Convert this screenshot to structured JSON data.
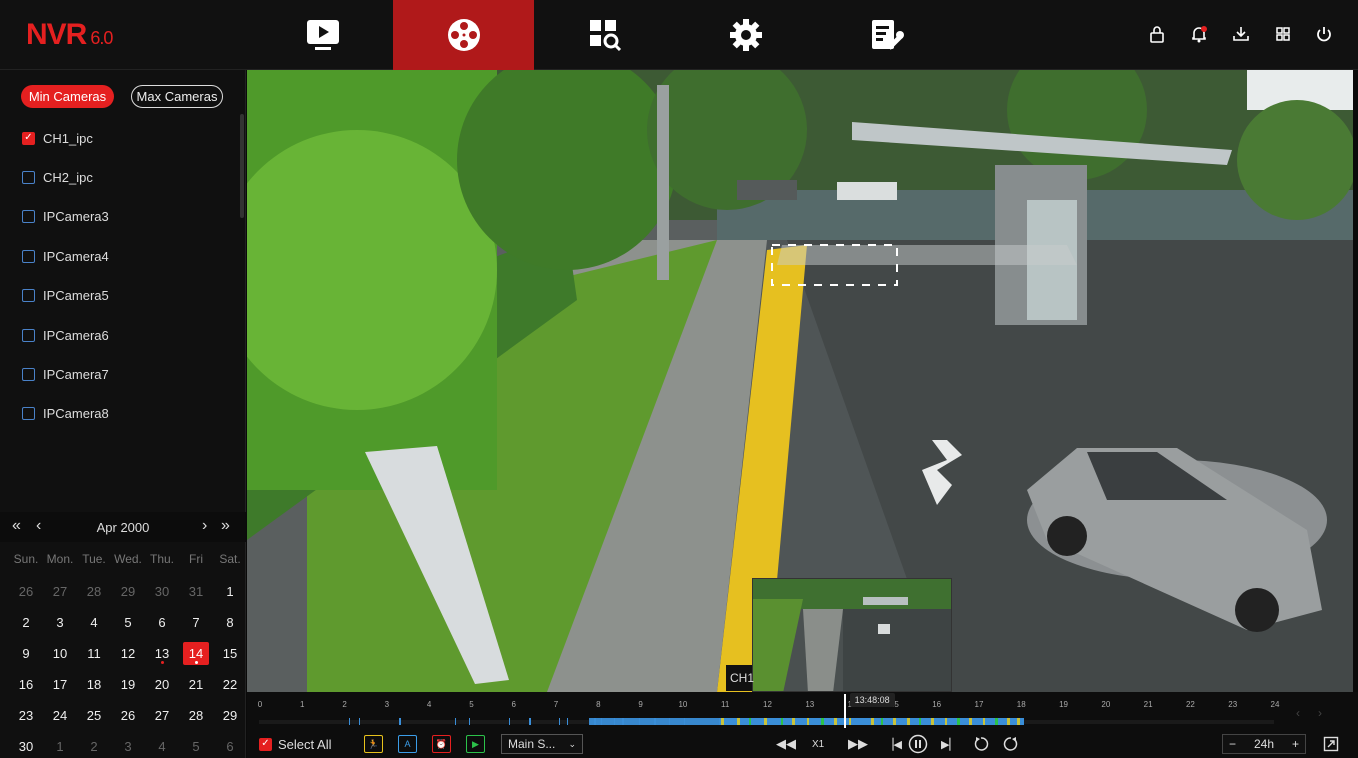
{
  "app": {
    "logo_main": "NVR",
    "logo_version": "6.0"
  },
  "nav_tabs": [
    {
      "name": "live-view",
      "icon": "play-screen-icon"
    },
    {
      "name": "playback",
      "icon": "film-reel-icon",
      "active": true
    },
    {
      "name": "search",
      "icon": "grid-search-icon"
    },
    {
      "name": "settings",
      "icon": "gear-icon"
    },
    {
      "name": "maintenance",
      "icon": "doc-wrench-icon"
    }
  ],
  "system_icons": [
    "lock-icon",
    "alarm-bell-icon",
    "download-icon",
    "layout-grid-icon",
    "power-icon"
  ],
  "sidebar": {
    "min_cameras_label": "Min Cameras",
    "max_cameras_label": "Max Cameras",
    "cameras": [
      {
        "label": "CH1_ipc",
        "checked": true
      },
      {
        "label": "CH2_ipc",
        "checked": false
      },
      {
        "label": "IPCamera3",
        "checked": false
      },
      {
        "label": "IPCamera4",
        "checked": false
      },
      {
        "label": "IPCamera5",
        "checked": false
      },
      {
        "label": "IPCamera6",
        "checked": false
      },
      {
        "label": "IPCamera7",
        "checked": false
      },
      {
        "label": "IPCamera8",
        "checked": false
      }
    ]
  },
  "calendar": {
    "month_label": "Apr 2000",
    "nav": {
      "prev_year": "«",
      "prev_month": "‹",
      "next_month": "›",
      "next_year": "»"
    },
    "weekdays": [
      "Sun.",
      "Mon.",
      "Tue.",
      "Wed.",
      "Thu.",
      "Fri",
      "Sat."
    ],
    "weeks": [
      [
        {
          "d": "26",
          "o": true
        },
        {
          "d": "27",
          "o": true
        },
        {
          "d": "28",
          "o": true
        },
        {
          "d": "29",
          "o": true
        },
        {
          "d": "30",
          "o": true
        },
        {
          "d": "31",
          "o": true
        },
        {
          "d": "1"
        }
      ],
      [
        {
          "d": "2"
        },
        {
          "d": "3"
        },
        {
          "d": "4"
        },
        {
          "d": "5"
        },
        {
          "d": "6"
        },
        {
          "d": "7"
        },
        {
          "d": "8"
        }
      ],
      [
        {
          "d": "9"
        },
        {
          "d": "10"
        },
        {
          "d": "11"
        },
        {
          "d": "12"
        },
        {
          "d": "13",
          "rec": true
        },
        {
          "d": "14",
          "sel": true
        },
        {
          "d": "15"
        }
      ],
      [
        {
          "d": "16"
        },
        {
          "d": "17"
        },
        {
          "d": "18"
        },
        {
          "d": "19"
        },
        {
          "d": "20"
        },
        {
          "d": "21"
        },
        {
          "d": "22"
        }
      ],
      [
        {
          "d": "23"
        },
        {
          "d": "24"
        },
        {
          "d": "25"
        },
        {
          "d": "26"
        },
        {
          "d": "27"
        },
        {
          "d": "28"
        },
        {
          "d": "29"
        }
      ],
      [
        {
          "d": "30"
        },
        {
          "d": "1",
          "o": true
        },
        {
          "d": "2",
          "o": true
        },
        {
          "d": "3",
          "o": true
        },
        {
          "d": "4",
          "o": true
        },
        {
          "d": "5",
          "o": true
        },
        {
          "d": "6",
          "o": true
        }
      ]
    ]
  },
  "video": {
    "channel_label": "CH1"
  },
  "timeline": {
    "hours": [
      "0",
      "1",
      "2",
      "3",
      "4",
      "5",
      "6",
      "7",
      "8",
      "9",
      "10",
      "11",
      "12",
      "13",
      "14",
      "15",
      "16",
      "17",
      "18",
      "19",
      "20",
      "21",
      "22",
      "23",
      "24"
    ],
    "current_time": "13:48:08",
    "cursor_hour": 13.8
  },
  "controls": {
    "select_all_label": "Select All",
    "select_all_checked": true,
    "event_filters": [
      {
        "icon": "motion-person-icon",
        "color": "#e8c21c"
      },
      {
        "icon": "ai-person-icon",
        "color": "#3b9de8"
      },
      {
        "icon": "alarm-icon",
        "color": "#e52020"
      },
      {
        "icon": "continuous-record-icon",
        "color": "#2cc24a"
      }
    ],
    "stream_value": "Main S...",
    "speed_label": "X1",
    "zoom_value": "24h",
    "zoom_minus": "−",
    "zoom_plus": "+"
  }
}
